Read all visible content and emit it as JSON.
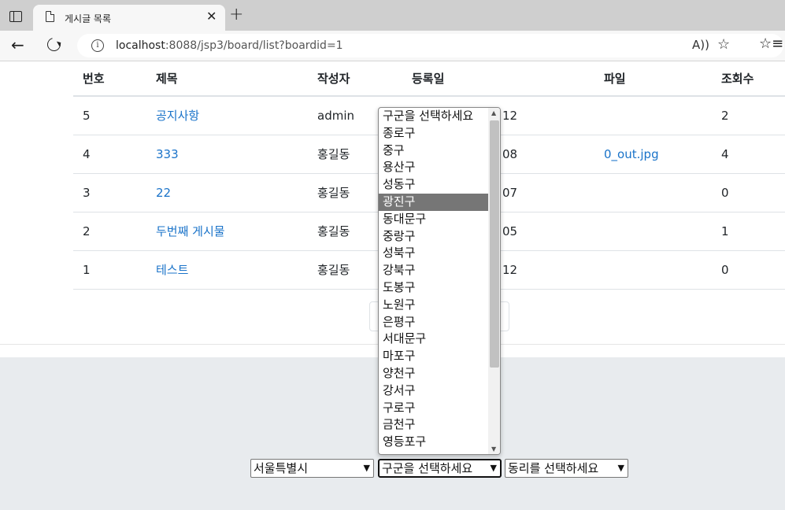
{
  "browser": {
    "tab_title": "게시글 목록",
    "tab_close": "✕",
    "new_tab": "+",
    "url_host": "localhost",
    "url_rest": ":8088/jsp3/board/list?boardid=1"
  },
  "table": {
    "headers": [
      "번호",
      "제목",
      "작성자",
      "등록일",
      "파일",
      "조회수"
    ],
    "rows": [
      {
        "no": "5",
        "title": "공지사항",
        "author": "admin",
        "date": "12",
        "file": "",
        "views": "2"
      },
      {
        "no": "4",
        "title": "333",
        "author": "홍길동",
        "date": "08",
        "file": "0_out.jpg",
        "views": "4"
      },
      {
        "no": "3",
        "title": "22",
        "author": "홍길동",
        "date": "07",
        "file": "",
        "views": "0"
      },
      {
        "no": "2",
        "title": "두번째 게시물",
        "author": "홍길동",
        "date": "05",
        "file": "",
        "views": "1"
      },
      {
        "no": "1",
        "title": "테스트",
        "author": "홍길동",
        "date": "12",
        "file": "",
        "views": "0"
      }
    ]
  },
  "selects": {
    "city": "서울특별시",
    "gu": "구군을 선택하세요",
    "dong": "동리를 선택하세요"
  },
  "dropdown": {
    "options": [
      "구군을 선택하세요",
      "종로구",
      "중구",
      "용산구",
      "성동구",
      "광진구",
      "동대문구",
      "중랑구",
      "성북구",
      "강북구",
      "도봉구",
      "노원구",
      "은평구",
      "서대문구",
      "마포구",
      "양천구",
      "강서구",
      "구로구",
      "금천구",
      "영등포구"
    ],
    "highlighted": "광진구"
  },
  "colors": {
    "link": "#1a73c9",
    "highlight": "#767676",
    "footer_bg": "#e8ebee"
  },
  "icons": [
    "window-icon",
    "document-icon",
    "back-icon",
    "reload-icon",
    "info-icon",
    "read-aloud-icon",
    "favorite-add-icon",
    "favorites-icon"
  ]
}
